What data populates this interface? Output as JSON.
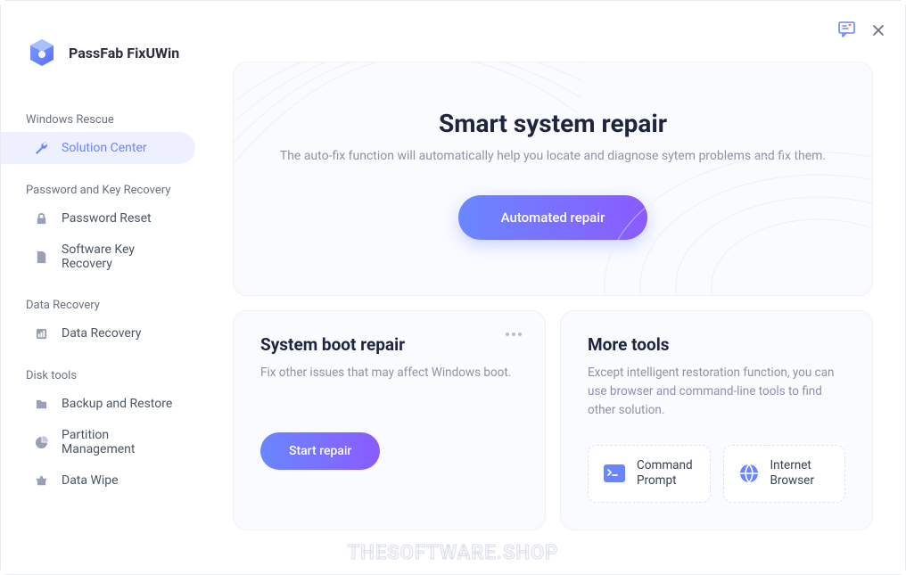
{
  "brand": {
    "name": "PassFab FixUWin"
  },
  "sidebar": {
    "sections": [
      {
        "label": "Windows Rescue",
        "items": [
          {
            "icon": "wrench",
            "label": "Solution Center",
            "active": true
          }
        ]
      },
      {
        "label": "Password and Key Recovery",
        "items": [
          {
            "icon": "lock",
            "label": "Password Reset"
          },
          {
            "icon": "key-doc",
            "label": "Software Key Recovery"
          }
        ]
      },
      {
        "label": "Data Recovery",
        "items": [
          {
            "icon": "bars",
            "label": "Data Recovery"
          }
        ]
      },
      {
        "label": "Disk tools",
        "items": [
          {
            "icon": "folder",
            "label": "Backup and Restore"
          },
          {
            "icon": "pie",
            "label": "Partition Management"
          },
          {
            "icon": "wipe",
            "label": "Data Wipe"
          }
        ]
      }
    ]
  },
  "hero": {
    "title": "Smart system repair",
    "subtitle": "The auto-fix function will automatically help you locate and diagnose sytem problems and fix them.",
    "cta": "Automated repair"
  },
  "boot": {
    "title": "System boot repair",
    "desc": "Fix other issues that may affect Windows boot.",
    "cta": "Start repair"
  },
  "tools": {
    "title": "More tools",
    "desc": "Except intelligent restoration function, you can use browser and command-line tools to find other solution.",
    "items": [
      {
        "icon": "terminal",
        "label": "Command Prompt"
      },
      {
        "icon": "globe",
        "label": "Internet Browser"
      }
    ]
  },
  "watermark": "THESOFTWARE.SHOP"
}
